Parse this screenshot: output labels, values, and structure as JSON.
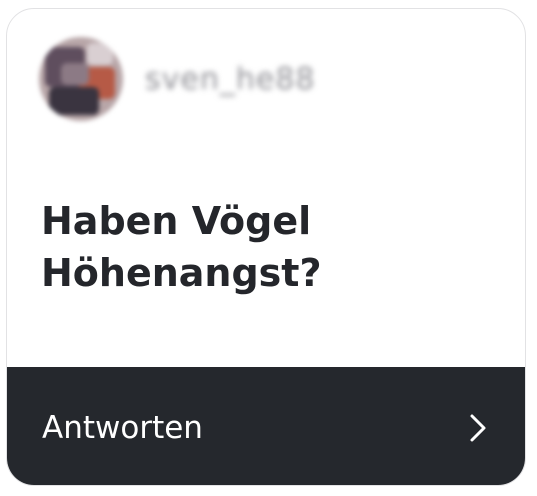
{
  "user": {
    "avatar": "blurred-profile-photo",
    "username": "sven_he88"
  },
  "question": {
    "text": "Haben Vögel Höhenangst?"
  },
  "footer": {
    "answer_label": "Antworten",
    "icon": "chevron-right-icon"
  },
  "colors": {
    "card_background": "#ffffff",
    "card_border": "#e2e2e4",
    "footer_background": "#25282d",
    "question_text": "#24262b",
    "footer_text": "#ffffff"
  }
}
